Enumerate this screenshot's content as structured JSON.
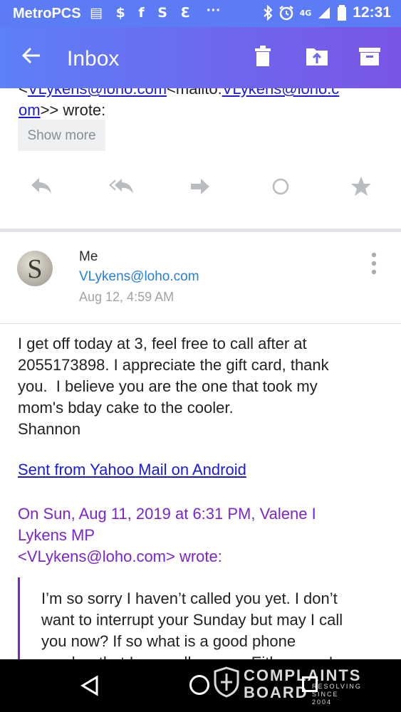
{
  "status_bar": {
    "carrier": "MetroPCS",
    "notification_icons": "▤ $ f S ℇ",
    "overflow": "···",
    "network": "4G",
    "time": "12:31",
    "icons": [
      "bluetooth-icon",
      "alarm-icon",
      "signal-icon",
      "battery-icon"
    ]
  },
  "app_bar": {
    "title": "Inbox",
    "icons": [
      "back-arrow-icon",
      "trash-icon",
      "move-to-folder-icon",
      "archive-icon"
    ]
  },
  "previous_message": {
    "quote_email": "VLykens@loho.com",
    "quote_mailto_prefix": "<mailto:",
    "quote_email_2": "VLykens@loho.c",
    "quote_email_3": "om",
    "quote_wrote": ">> wrote:",
    "quote_open": "<",
    "show_more_label": "Show more",
    "action_icons": [
      "reply-icon",
      "reply-all-icon",
      "forward-icon",
      "unread-circle-icon",
      "star-icon"
    ]
  },
  "message": {
    "sender": "Me",
    "email": "VLykens@loho.com",
    "date": "Aug 12, 4:59 AM",
    "avatar_letter": "S",
    "body_lines": [
      "I get off today at 3, feel free to call after at",
      "2055173898. I appreciate the gift card, thank",
      "you.  I believe you are the one that took my",
      "mom's bday cake to the cooler.",
      "Shannon"
    ],
    "sent_from": "Sent from Yahoo Mail on Android",
    "quote_header_lines": [
      "On Sun, Aug 11, 2019 at 6:31 PM, Valene I",
      "Lykens MP",
      "<VLykens@loho.com> wrote:"
    ],
    "quoted_lines": [
      "I’m so sorry I haven’t called you yet. I don’t",
      "want to interrupt your Sunday but may I call",
      "you now? If so what is a good phone",
      "number that I can call you on. Either way I"
    ]
  },
  "watermark": {
    "line1": "COMPLAINTS",
    "line2": "BOARD",
    "line3a": "RESOLVING",
    "line3b": "SINCE 2004"
  },
  "colors": {
    "app_bar_start": "#5d80f6",
    "app_bar_end": "#7a55e6",
    "link": "#1a1adf",
    "email_blue": "#2480d8",
    "quote_purple": "#7b26c8"
  }
}
